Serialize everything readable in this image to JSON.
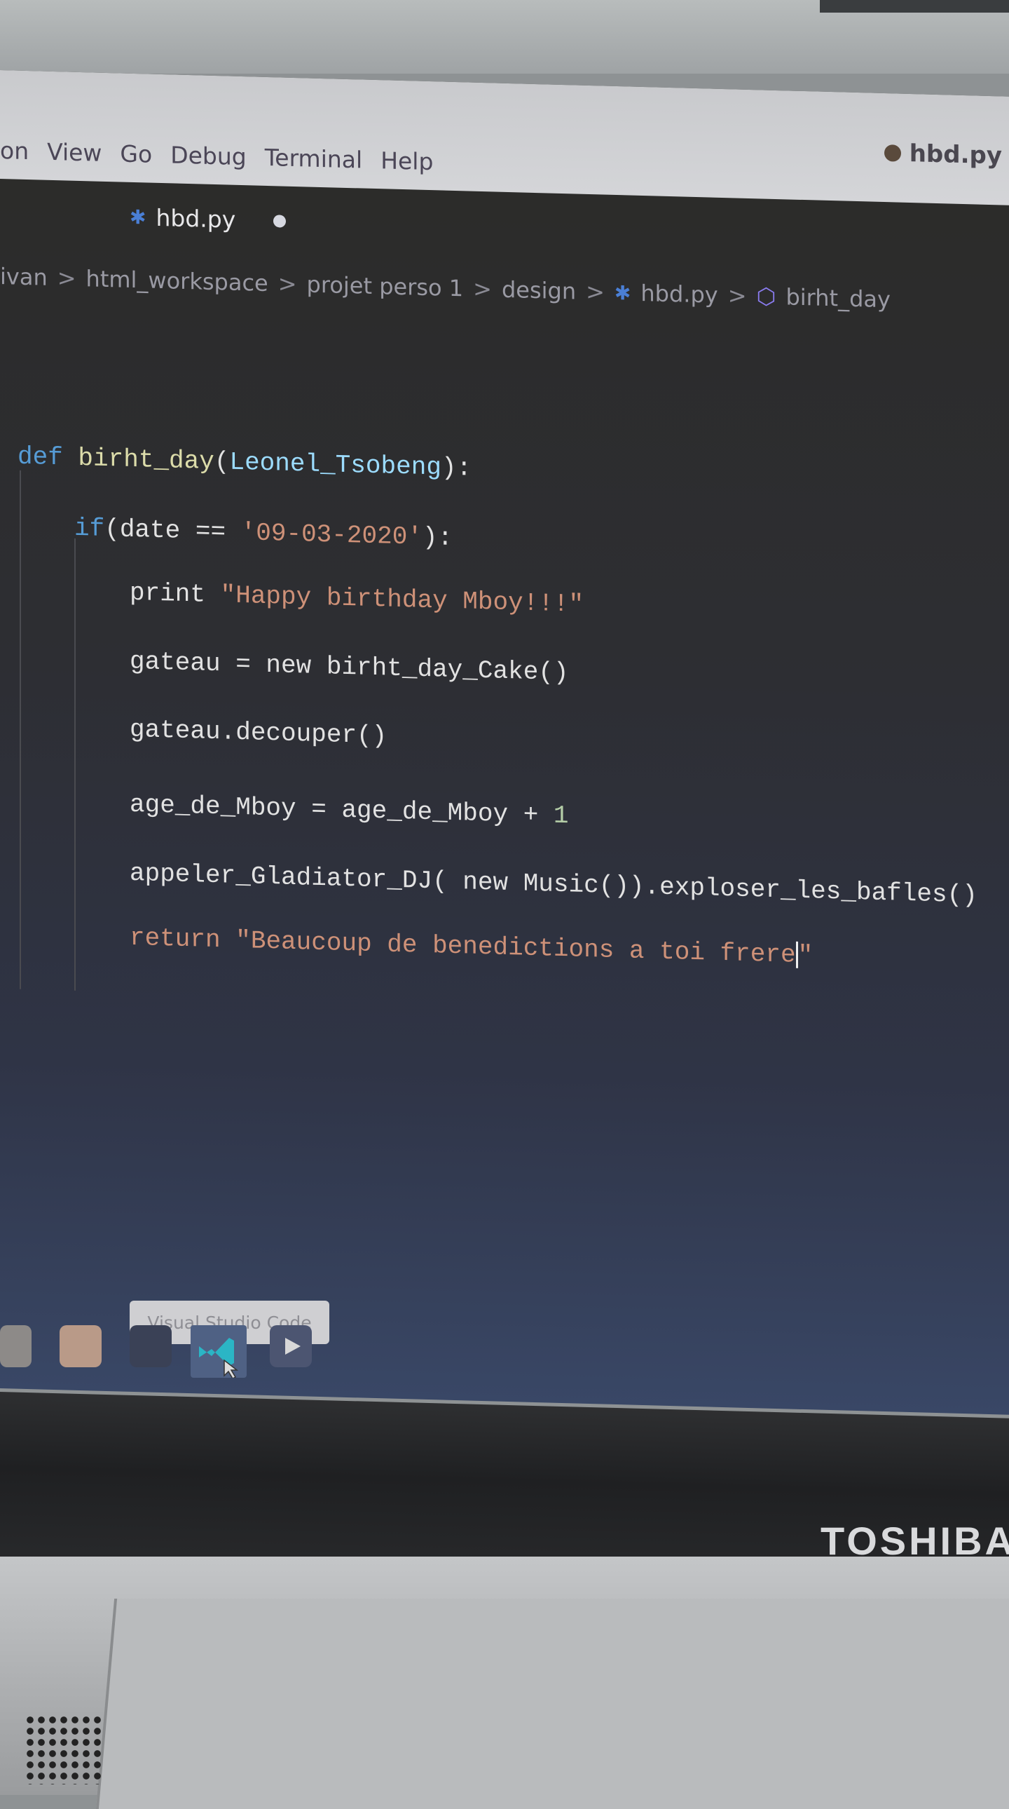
{
  "menubar": {
    "items": [
      "on",
      "View",
      "Go",
      "Debug",
      "Terminal",
      "Help"
    ],
    "window_title": "hbd.py"
  },
  "tab": {
    "label": "hbd.py",
    "icon": "python-icon",
    "modified": true
  },
  "breadcrumb": [
    "ivan",
    "html_workspace",
    "projet perso 1",
    "design",
    "hbd.py",
    "birht_day"
  ],
  "colors": {
    "keyword": "#569cd6",
    "function": "#dcdcaa",
    "param": "#9cdcfe",
    "string": "#ce9178",
    "text": "#e2e2e2",
    "number": "#b5cea8"
  },
  "code": [
    {
      "indent": 0,
      "tokens": [
        {
          "t": "def ",
          "c": "keyword"
        },
        {
          "t": "birht_day",
          "c": "function"
        },
        {
          "t": "(",
          "c": "text"
        },
        {
          "t": "Leonel_Tsobeng",
          "c": "param"
        },
        {
          "t": "):",
          "c": "text"
        }
      ]
    },
    {
      "indent": 1,
      "tokens": [
        {
          "t": "if",
          "c": "keyword"
        },
        {
          "t": "(date == ",
          "c": "text"
        },
        {
          "t": "'09-03-2020'",
          "c": "string"
        },
        {
          "t": "):",
          "c": "text"
        }
      ]
    },
    {
      "indent": 2,
      "tokens": [
        {
          "t": "print ",
          "c": "text"
        },
        {
          "t": "\"Happy birthday Mboy!!!\"",
          "c": "string"
        }
      ]
    },
    {
      "indent": 2,
      "tokens": [
        {
          "t": "gateau = new birht_day_Cake()",
          "c": "text"
        }
      ]
    },
    {
      "indent": 2,
      "tokens": [
        {
          "t": "gateau.decouper()",
          "c": "text"
        }
      ]
    },
    {
      "indent": 2,
      "tokens": [
        {
          "t": "age_de_Mboy = age_de_Mboy + ",
          "c": "text"
        },
        {
          "t": "1",
          "c": "number"
        }
      ]
    },
    {
      "indent": 2,
      "tokens": [
        {
          "t": "appeler_Gladiator_DJ( new Music()).exploser_les_bafles()",
          "c": "text"
        }
      ]
    },
    {
      "indent": 2,
      "tokens": [
        {
          "t": "return ",
          "c": "string"
        },
        {
          "t": "\"Beaucoup de benedictions a toi frere",
          "c": "string"
        },
        {
          "t": "|",
          "c": "cursor"
        },
        {
          "t": "\"",
          "c": "string"
        }
      ]
    }
  ],
  "taskbar": {
    "tooltip": "Visual Studio Code"
  },
  "laptop": {
    "brand": "TOSHIBA"
  }
}
